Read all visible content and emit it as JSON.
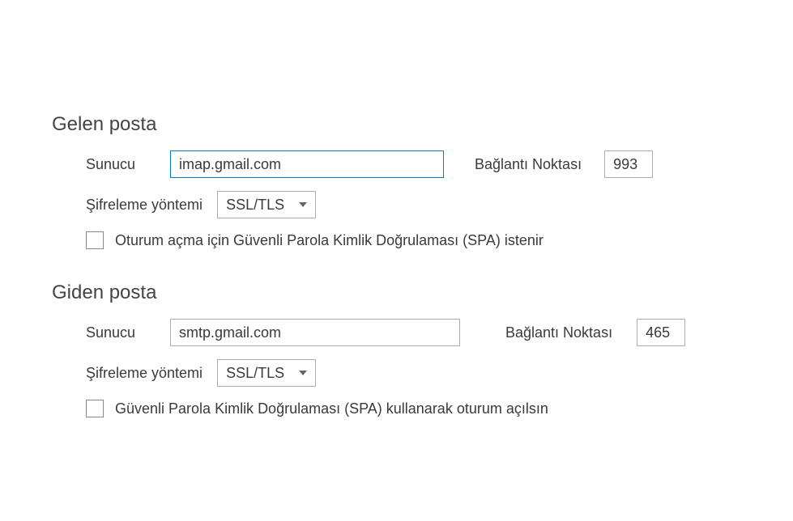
{
  "incoming": {
    "title": "Gelen posta",
    "server_label": "Sunucu",
    "server_value": "imap.gmail.com",
    "port_label": "Bağlantı Noktası",
    "port_value": "993",
    "encryption_label": "Şifreleme yöntemi",
    "encryption_value": "SSL/TLS",
    "spa_label": "Oturum açma için Güvenli Parola Kimlik Doğrulaması (SPA) istenir"
  },
  "outgoing": {
    "title": "Giden posta",
    "server_label": "Sunucu",
    "server_value": "smtp.gmail.com",
    "port_label": "Bağlantı Noktası",
    "port_value": "465",
    "encryption_label": "Şifreleme yöntemi",
    "encryption_value": "SSL/TLS",
    "spa_label": "Güvenli Parola Kimlik Doğrulaması (SPA) kullanarak oturum açılsın"
  }
}
